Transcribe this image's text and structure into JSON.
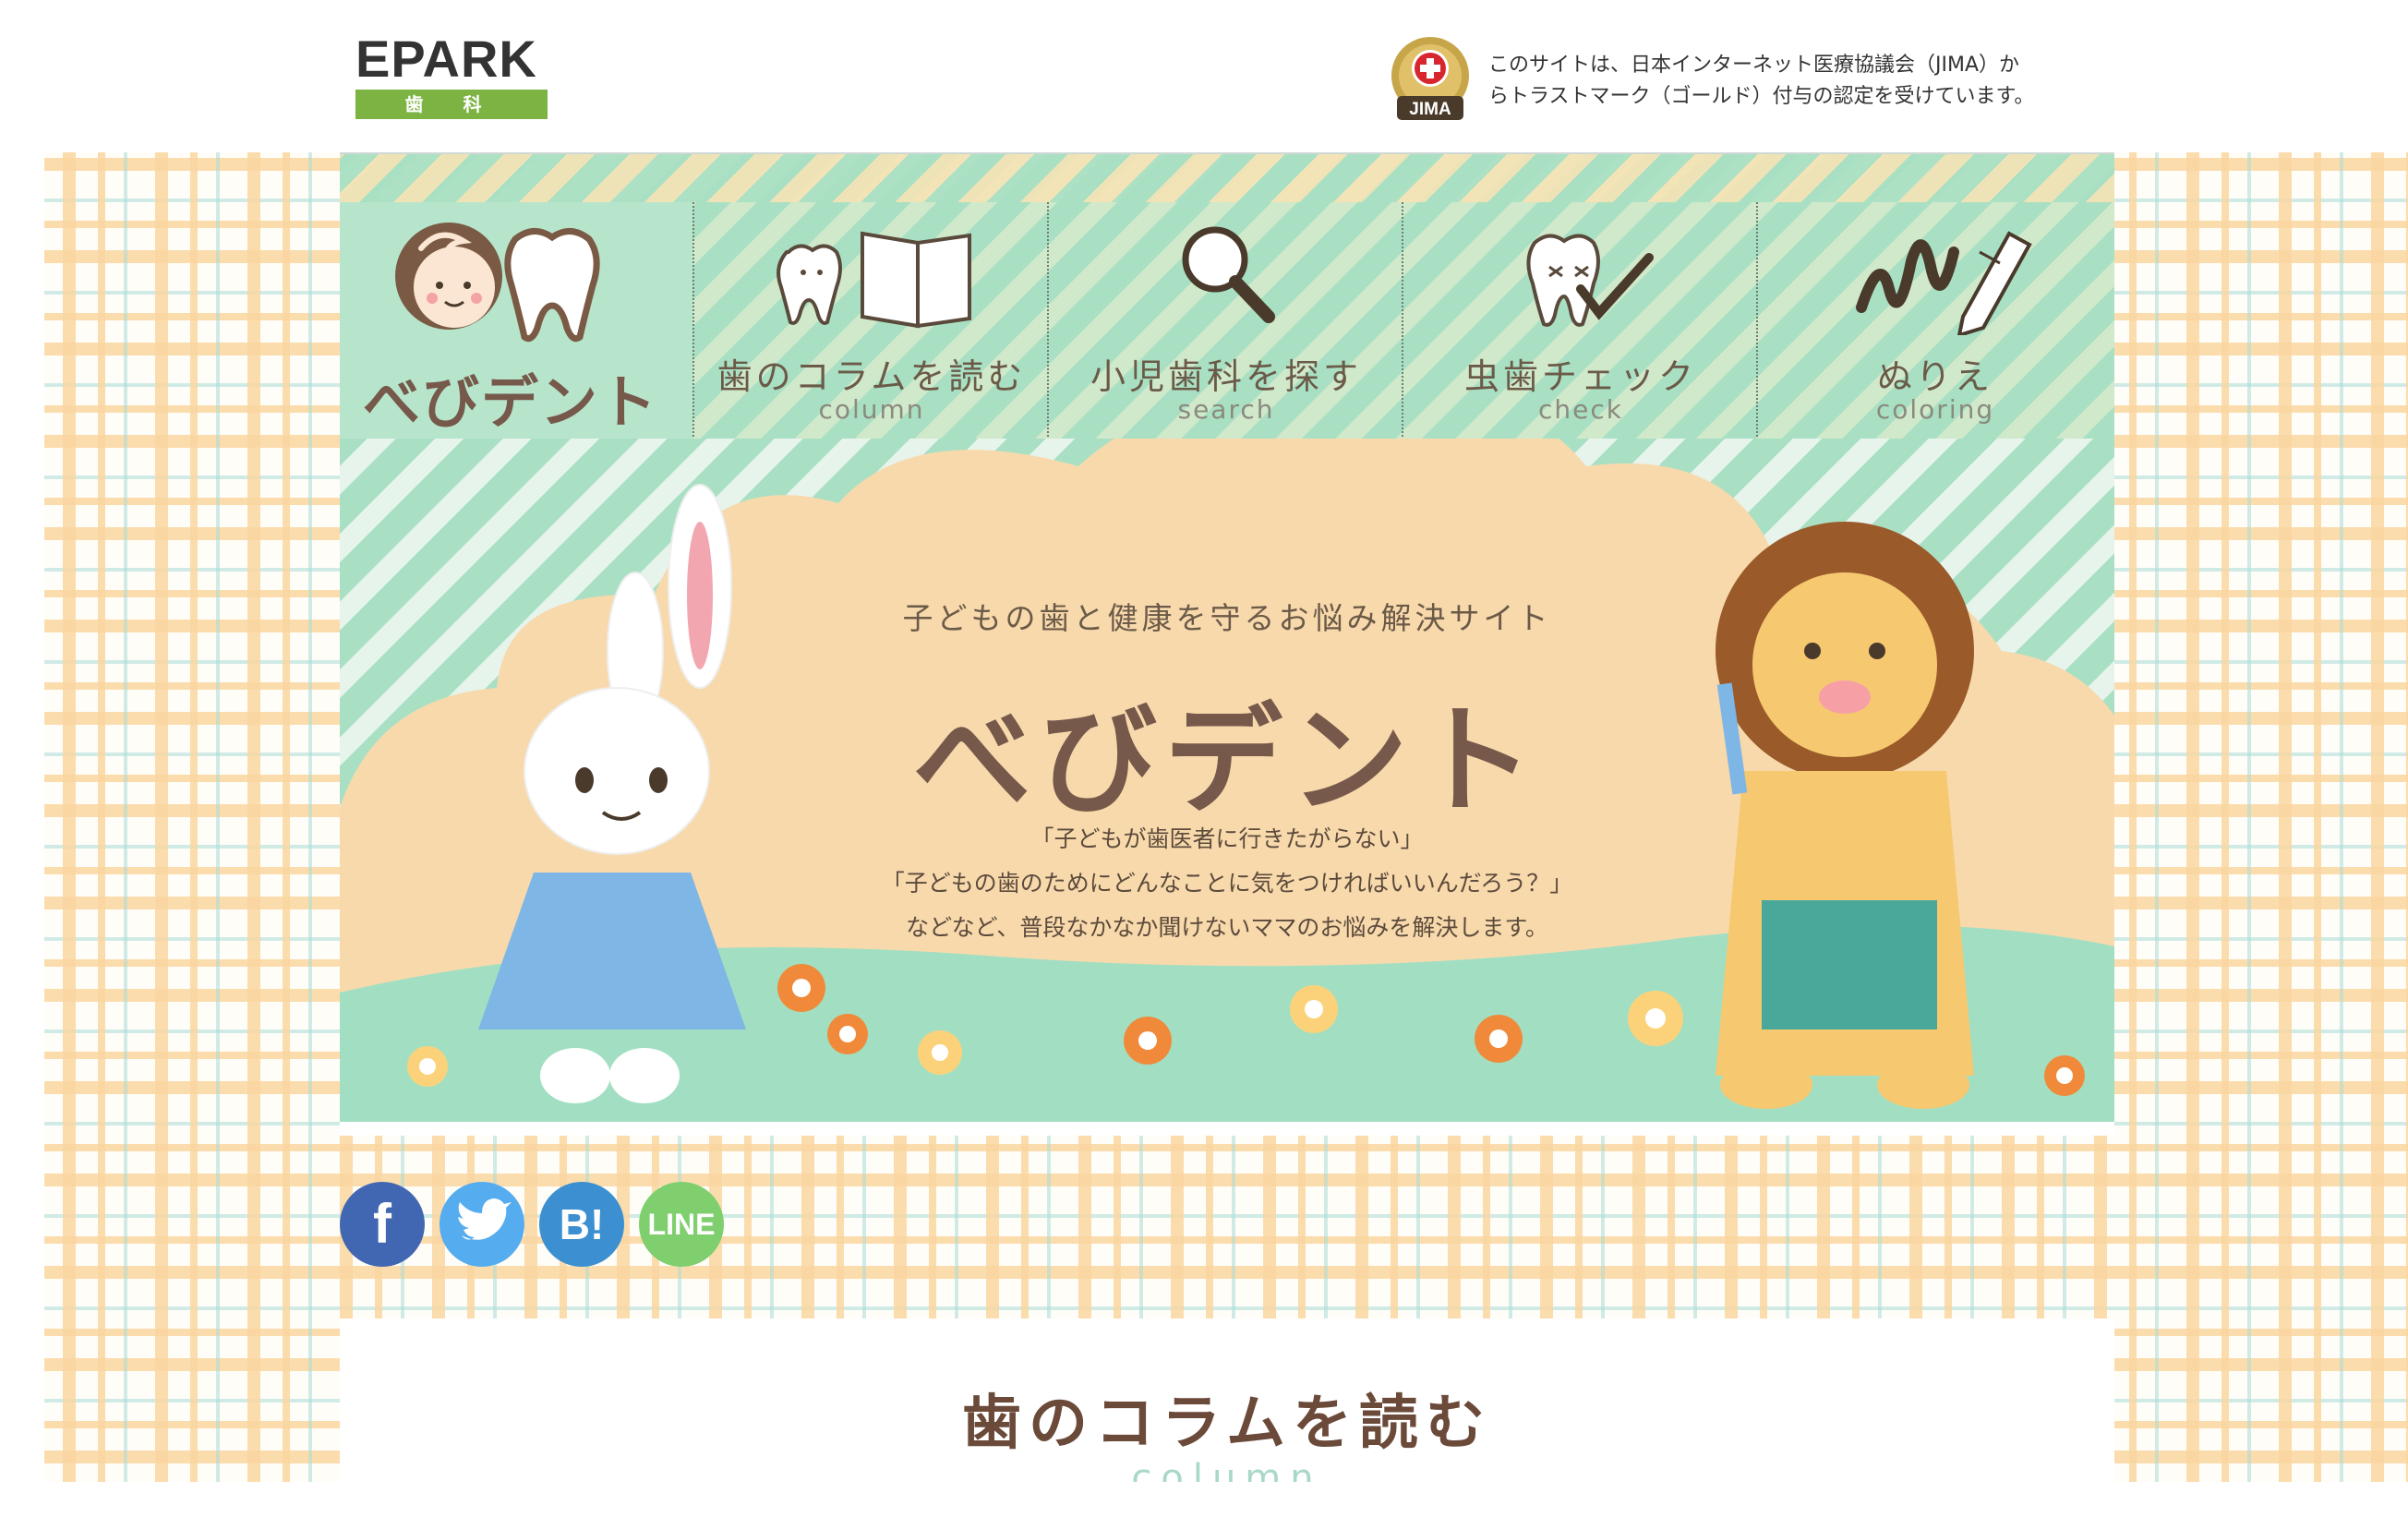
{
  "header": {
    "logo": {
      "brand": "EPARK",
      "sub": "歯 科"
    },
    "jima": {
      "badge_text": "JIMA",
      "line1": "このサイトは、日本インターネット医療協議会（JIMA）か",
      "line2": "らトラストマーク（ゴールド）付与の認定を受けています。"
    }
  },
  "nav": {
    "logo_text": "べびデント",
    "items": [
      {
        "label": "歯のコラムを読む",
        "sub": "column",
        "icon": "tooth-book-icon"
      },
      {
        "label": "小児歯科を探す",
        "sub": "search",
        "icon": "magnifier-icon"
      },
      {
        "label": "虫歯チェック",
        "sub": "check",
        "icon": "tooth-check-icon"
      },
      {
        "label": "ぬりえ",
        "sub": "coloring",
        "icon": "pencil-scribble-icon"
      }
    ]
  },
  "hero": {
    "tagline": "子どもの歯と健康を守るお悩み解決サイト",
    "title": "べびデント",
    "desc1": "「子どもが歯医者に行きたがらない」",
    "desc2": "「子どもの歯のためにどんなことに気をつければいいんだろう？」",
    "desc3": "などなど、普段なかなか聞けないママのお悩みを解決します。"
  },
  "social": {
    "facebook": "f",
    "twitter_icon": "twitter-bird-icon",
    "hatena": "B!",
    "line": "LINE",
    "colors": {
      "facebook": "#4267b2",
      "twitter": "#55acee",
      "hatena": "#3c8fd0",
      "line": "#7fcf6f"
    }
  },
  "content": {
    "title": "歯のコラムを読む",
    "sub": "column"
  },
  "colors": {
    "mint": "#a9e0c4",
    "peach": "#f8d9ac",
    "brown": "#76594a"
  }
}
